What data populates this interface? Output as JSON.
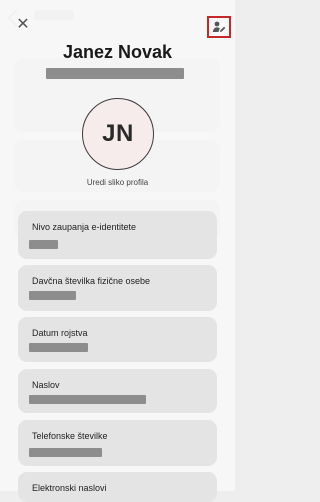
{
  "header": {
    "name": "Janez Novak"
  },
  "avatar": {
    "initials": "JN",
    "caption": "Uredi sliko profila"
  },
  "fields": [
    {
      "label": "Nivo zaupanja e-identitete"
    },
    {
      "label": "Davčna številka fizične osebe"
    },
    {
      "label": "Datum rojstva"
    },
    {
      "label": "Naslov"
    },
    {
      "label": "Telefonske številke"
    },
    {
      "label": "Elektronski naslovi"
    }
  ],
  "colors": {
    "highlight_border": "#c62828",
    "avatar_bg": "#f6ecec",
    "card_bg": "#e4e4e4",
    "redaction": "#8d8d8d"
  },
  "icons": {
    "close": "close-icon",
    "edit_profile": "user-edit-icon"
  }
}
